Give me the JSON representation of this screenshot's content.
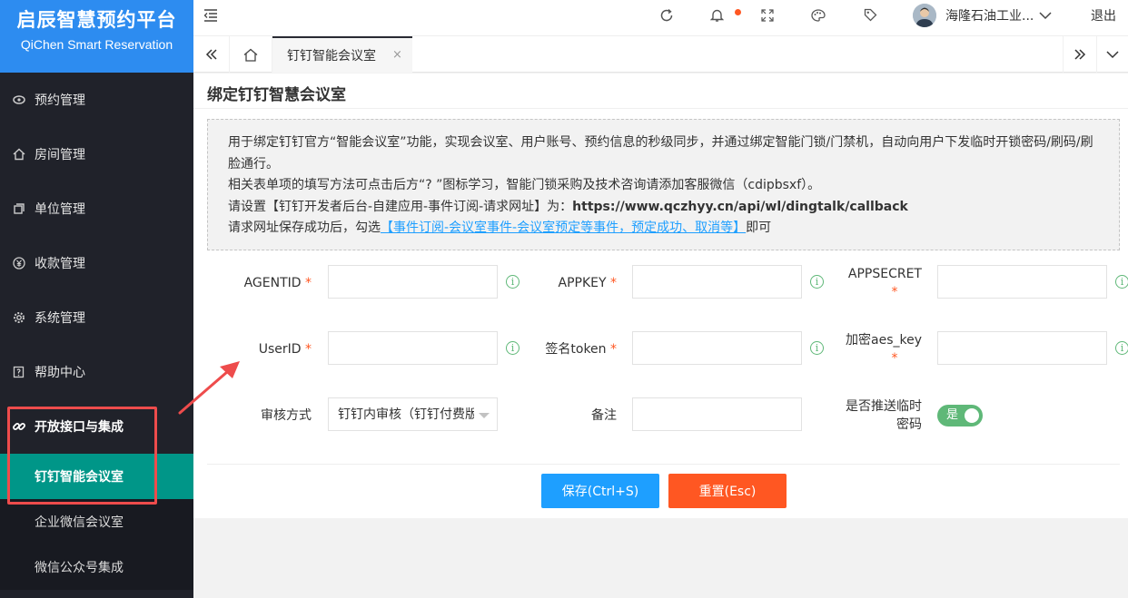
{
  "app": {
    "title_cn": "启辰智慧预约平台",
    "title_en": "QiChen Smart Reservation"
  },
  "sidebar": {
    "items": [
      {
        "label": "预约管理",
        "icon": "reservation-icon"
      },
      {
        "label": "房间管理",
        "icon": "home-icon"
      },
      {
        "label": "单位管理",
        "icon": "building-icon"
      },
      {
        "label": "收款管理",
        "icon": "yuan-icon"
      },
      {
        "label": "系统管理",
        "icon": "gear-icon"
      },
      {
        "label": "帮助中心",
        "icon": "help-icon"
      },
      {
        "label": "开放接口与集成",
        "icon": "link-icon"
      }
    ],
    "subitems": [
      {
        "label": "钉钉智能会议室"
      },
      {
        "label": "企业微信会议室"
      },
      {
        "label": "微信公众号集成"
      }
    ]
  },
  "header": {
    "user_name": "海隆石油工业...",
    "logout": "退出"
  },
  "tabs": {
    "active": "钉钉智能会议室",
    "close": "×"
  },
  "page": {
    "title": "绑定钉钉智慧会议室",
    "notice": {
      "line1": "用于绑定钉钉官方“智能会议室”功能，实现会议室、用户账号、预约信息的秒级同步，并通过绑定智能门锁/门禁机，自动向用户下发临时开锁密码/刷码/刷脸通行。",
      "line2": "相关表单项的填写方法可点击后方“? ”图标学习，智能门锁采购及技术咨询请添加客服微信（cdipbsxf）。",
      "line3_prefix": "请设置【钉钉开发者后台-自建应用-事件订阅-请求网址】为：",
      "line3_url": "https://www.qczhyy.cn/api/wl/dingtalk/callback",
      "line4_prefix": "请求网址保存成功后，勾选",
      "line4_link": "【事件订阅-会议室事件-会议室预定等事件，预定成功、取消等】",
      "line4_suffix": "即可"
    }
  },
  "form": {
    "agentid_label": "AGENTID",
    "appkey_label": "APPKEY",
    "appsecret_label": "APPSECRET",
    "userid_label": "UserID",
    "token_label": "签名token",
    "aes_label": "加密aes_key",
    "audit_label": "审核方式",
    "audit_value": "钉钉内审核（钉钉付费版）",
    "remark_label": "备注",
    "push_label_1": "是否推送临时",
    "push_label_2": "密码",
    "push_toggle": "是",
    "required_mark": "*",
    "info_glyph": "i"
  },
  "buttons": {
    "save": "保存(Ctrl+S)",
    "reset": "重置(Esc)"
  },
  "colors": {
    "sidebar_bg": "#20222a",
    "logo_bg": "#2d8cf0",
    "active_sub": "#009688",
    "save": "#1e9fff",
    "reset": "#ff5722",
    "toggle": "#5fb878",
    "highlight": "#ee4c4c"
  }
}
